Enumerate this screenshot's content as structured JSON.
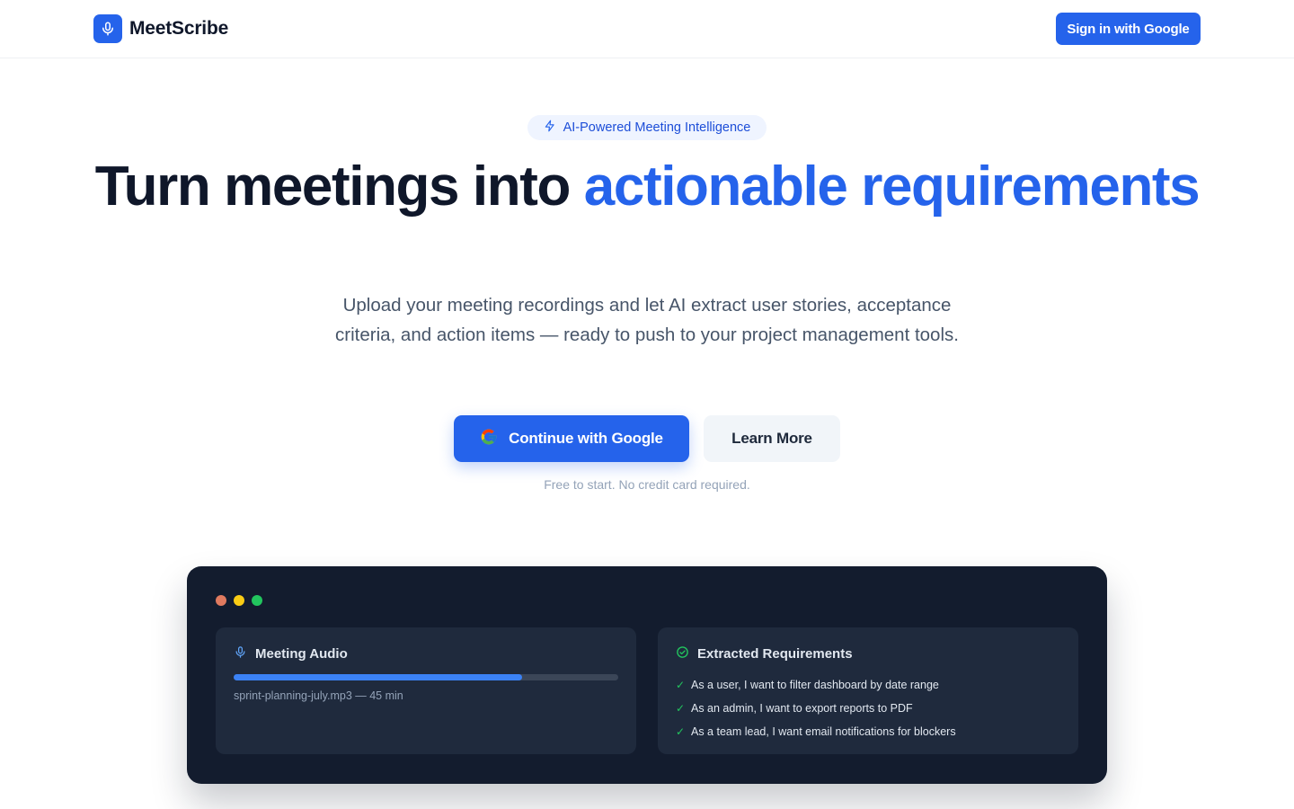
{
  "header": {
    "brand_name": "MeetScribe",
    "logo_icon": "microphone-icon",
    "signin_label": "Sign in with Google"
  },
  "hero": {
    "badge": "AI-Powered Meeting Intelligence",
    "headline_main": "Turn meetings into ",
    "headline_accent": "actionable requirements",
    "subtext": "Upload your meeting recordings and let AI extract user stories, acceptance criteria, and action items — ready to push to your project management tools.",
    "cta_primary": "Continue with Google",
    "cta_secondary": "Learn More",
    "fineprint": "Free to start. No credit card required."
  },
  "demo": {
    "window_dots": [
      "#e07a5f",
      "#facc15",
      "#22c55e"
    ],
    "audio_card": {
      "title": "Meeting Audio",
      "file": "sprint-planning-july.mp3 — 45 min",
      "progress_percent": 75
    },
    "requirements_card": {
      "title": "Extracted Requirements",
      "items": [
        "As a user, I want to filter dashboard by date range",
        "As an admin, I want to export reports to PDF",
        "As a team lead, I want email notifications for blockers"
      ]
    }
  },
  "colors": {
    "primary": "#2563eb",
    "dark_panel": "#131c2e",
    "card": "#1f2a3d",
    "success": "#22c55e"
  }
}
